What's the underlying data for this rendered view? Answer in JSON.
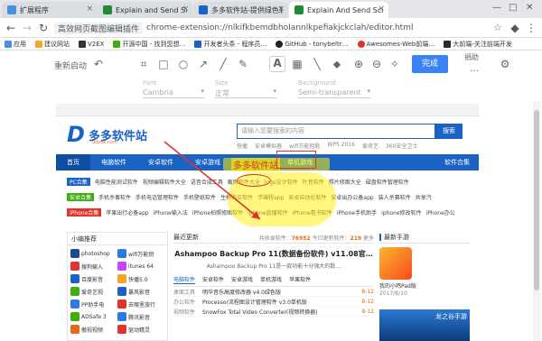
{
  "tabs": [
    {
      "label": "扩展程序",
      "active": false,
      "favicon_color": "#4a90e2"
    },
    {
      "label": "Explain and Send Scre…",
      "active": false,
      "favicon_color": "#1e8a3a"
    },
    {
      "label": "多多软件站-提供绿色软…",
      "active": false,
      "favicon_color": "#1a63c4"
    },
    {
      "label": "Explain And Send Scre…",
      "active": true,
      "favicon_color": "#1e8a3a"
    }
  ],
  "window_controls": {
    "minimize": "—",
    "maximize": "□",
    "close": "✕"
  },
  "address": {
    "extension_name": "高效网页截图编辑插件",
    "url": "chrome-extension://nlkifkbemdbhoIannlkpefiakjckclah/editor.html"
  },
  "bookmarks": [
    {
      "label": "应用",
      "color": "#4a90e2"
    },
    {
      "label": "建议网站",
      "color": "#f5a623"
    },
    {
      "label": "V2EX",
      "color": "#333333"
    },
    {
      "label": "开源中国 - 找到您想…",
      "color": "#3eaf0e"
    },
    {
      "label": "开发者头条 - 程序员…",
      "color": "#1a63c4"
    },
    {
      "label": "GitHub - tonybeltr…",
      "color": "#222222"
    },
    {
      "label": "Awesomes-Web前端…",
      "color": "#e0332e"
    },
    {
      "label": "大前端-关注前端开发",
      "color": "#2b2b2b"
    }
  ],
  "editor": {
    "left_label": "重新启动",
    "done_label": "完成",
    "donate_label": "捐助",
    "tool_icons": [
      "undo-icon",
      "crop-icon",
      "rectangle-icon",
      "ellipse-icon",
      "arrow-icon",
      "line-icon",
      "pencil-icon",
      "text-icon",
      "mosaic-icon",
      "blur-icon",
      "fill-icon",
      "zoom-in-icon",
      "zoom-out-icon",
      "magic-icon"
    ],
    "font_label": "Font",
    "font_value": "Cambria",
    "size_label": "Size",
    "size_value": "正常",
    "bg_label": "Background",
    "bg_value": "Semi-transparent"
  },
  "site": {
    "logo_name": "多多软件站",
    "logo_sub": "ddooo.com",
    "search_placeholder": "请输入您要搜索的内容",
    "search_button": "搜索",
    "hotwords": [
      "快播",
      "安卓模拟器",
      "wifi万能钥匙",
      "WPS 2016",
      "爱奇艺",
      "360安全卫士"
    ],
    "nav": [
      "首页",
      "电脑软件",
      "安卓软件",
      "安卓游戏",
      "单机游戏"
    ],
    "nav_right": "软件合集",
    "cat_rows": [
      {
        "tag": "PC合集",
        "tag_color": "#1a63c4",
        "items": [
          "电脑性能测试软件",
          "视频编辑软件大全",
          "语音合成工具",
          "截图软件大全",
          "logo设计软件",
          "叶音软件",
          "照片修图大全",
          "磁盘软件管理软件"
        ]
      },
      {
        "tag": "安卓合集",
        "tag_color": "#3eaf0e",
        "items": [
          "手机杀毒软件",
          "手机电话管理软件",
          "手机壁纸软件",
          "生鲜购买软件",
          "学编程app",
          "安卓自动化软件",
          "安卓出办公备app",
          "装人杀赛软件",
          "共享汽"
        ]
      },
      {
        "tag": "iPhone合集",
        "tag_color": "#e0332e",
        "items": [
          "苹果出行必备app",
          "iPhone输入法",
          "iPhone拍照修图软件",
          "iphone直播软件",
          "iPhone看书软件",
          "iPhone手机助手",
          "iphone修改软件",
          "iPhone办公"
        ]
      }
    ],
    "left_header": "小编推荐",
    "apps": [
      {
        "name": "photoshop",
        "color": "#1a4b8c"
      },
      {
        "name": "wifi万能钥",
        "color": "#2c7be5"
      },
      {
        "name": "搜狗输入",
        "color": "#e0332e"
      },
      {
        "name": "itunes 64",
        "color": "#c644fc"
      },
      {
        "name": "百度影音",
        "color": "#1a63c4"
      },
      {
        "name": "快播5.0",
        "color": "#f5a623"
      },
      {
        "name": "爱奇艺视",
        "color": "#3eaf0e"
      },
      {
        "name": "暴风影音",
        "color": "#1a63c4"
      },
      {
        "name": "PP助手电",
        "color": "#2c7be5"
      },
      {
        "name": "去哪里旅行",
        "color": "#e0332e"
      },
      {
        "name": "ADSafe 3",
        "color": "#3eaf0e"
      },
      {
        "name": "腾讯影音",
        "color": "#2c7be5"
      },
      {
        "name": "傲视视频",
        "color": "#e26c1a"
      },
      {
        "name": "驱动精灵",
        "color": "#e0332e"
      }
    ],
    "mid_header": "最近更新",
    "mid_count_label": "共收录软件：",
    "mid_count": "76952",
    "mid_today_label": "今日更新软件：",
    "mid_today": "219",
    "mid_more": "更多",
    "feature_title": "Ashampoo Backup Pro 11(数据备份软件) v11.08官…",
    "feature_sub": "Ashampoo Backup Pro 11是一款功能十分强大的数…",
    "mid_tabs": [
      "电脑软件",
      "安卓软件",
      "安卓游戏",
      "单机游戏",
      "苹果软件"
    ],
    "mid_rows": [
      {
        "cat": "桌面工具",
        "title": "明华音乐高度修改器 v4.0绿色版",
        "date": "8-12"
      },
      {
        "cat": "办公软件",
        "title": "Processor流程图设计管理软件 v3.0单机版",
        "date": "8-12"
      },
      {
        "cat": "视频软件",
        "title": "SnowFox Total Video Converter(视频转换器)",
        "date": "8-12"
      }
    ],
    "right_header": "最新手游",
    "game_name": "我的小鸡Pad版",
    "game_date": "2017/8/10",
    "game_banner": "龙之谷手游"
  },
  "annotation": {
    "label": "多多软件站",
    "color": "#e0332e"
  }
}
